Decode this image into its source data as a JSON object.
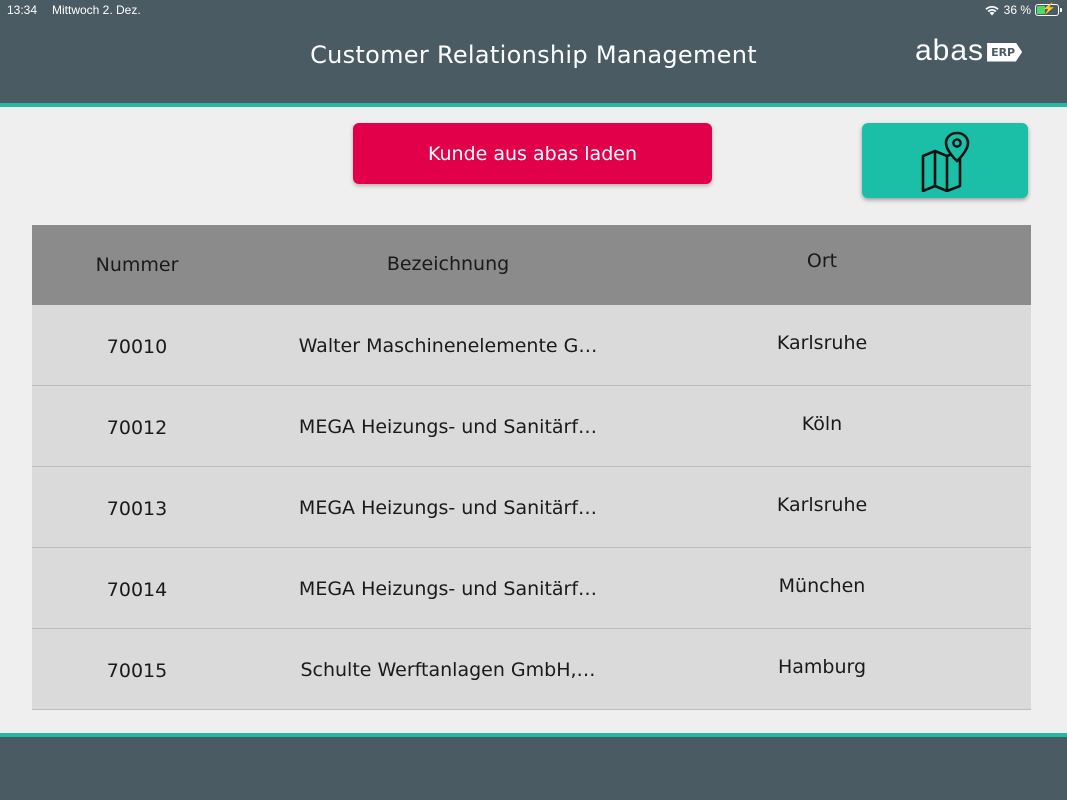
{
  "status_bar": {
    "time": "13:34",
    "date": "Mittwoch 2. Dez.",
    "battery": "36 %",
    "battery_level": 0.36
  },
  "header": {
    "title": "Customer Relationship Management",
    "logo_text": "abas",
    "logo_badge": "ERP"
  },
  "actions": {
    "load_label": "Kunde aus abas laden",
    "map_icon": "map-pin-icon"
  },
  "table": {
    "headers": {
      "number": "Nummer",
      "name": "Bezeichnung",
      "city": "Ort"
    },
    "rows": [
      {
        "number": "70010",
        "name": "Walter Maschinenelemente G…",
        "city": "Karlsruhe"
      },
      {
        "number": "70012",
        "name": "MEGA Heizungs- und Sanitärf…",
        "city": "Köln"
      },
      {
        "number": "70013",
        "name": "MEGA Heizungs- und Sanitärf…",
        "city": "Karlsruhe"
      },
      {
        "number": "70014",
        "name": "MEGA Heizungs- und Sanitärf…",
        "city": "München"
      },
      {
        "number": "70015",
        "name": "Schulte Werftanlagen GmbH,…",
        "city": "Hamburg"
      }
    ]
  },
  "colors": {
    "header_bg": "#4a5b63",
    "accent": "#22b8a3",
    "primary_button": "#e3004b",
    "map_button": "#1bbfa7",
    "table_header": "#8b8b8b",
    "table_row": "#dadada"
  }
}
